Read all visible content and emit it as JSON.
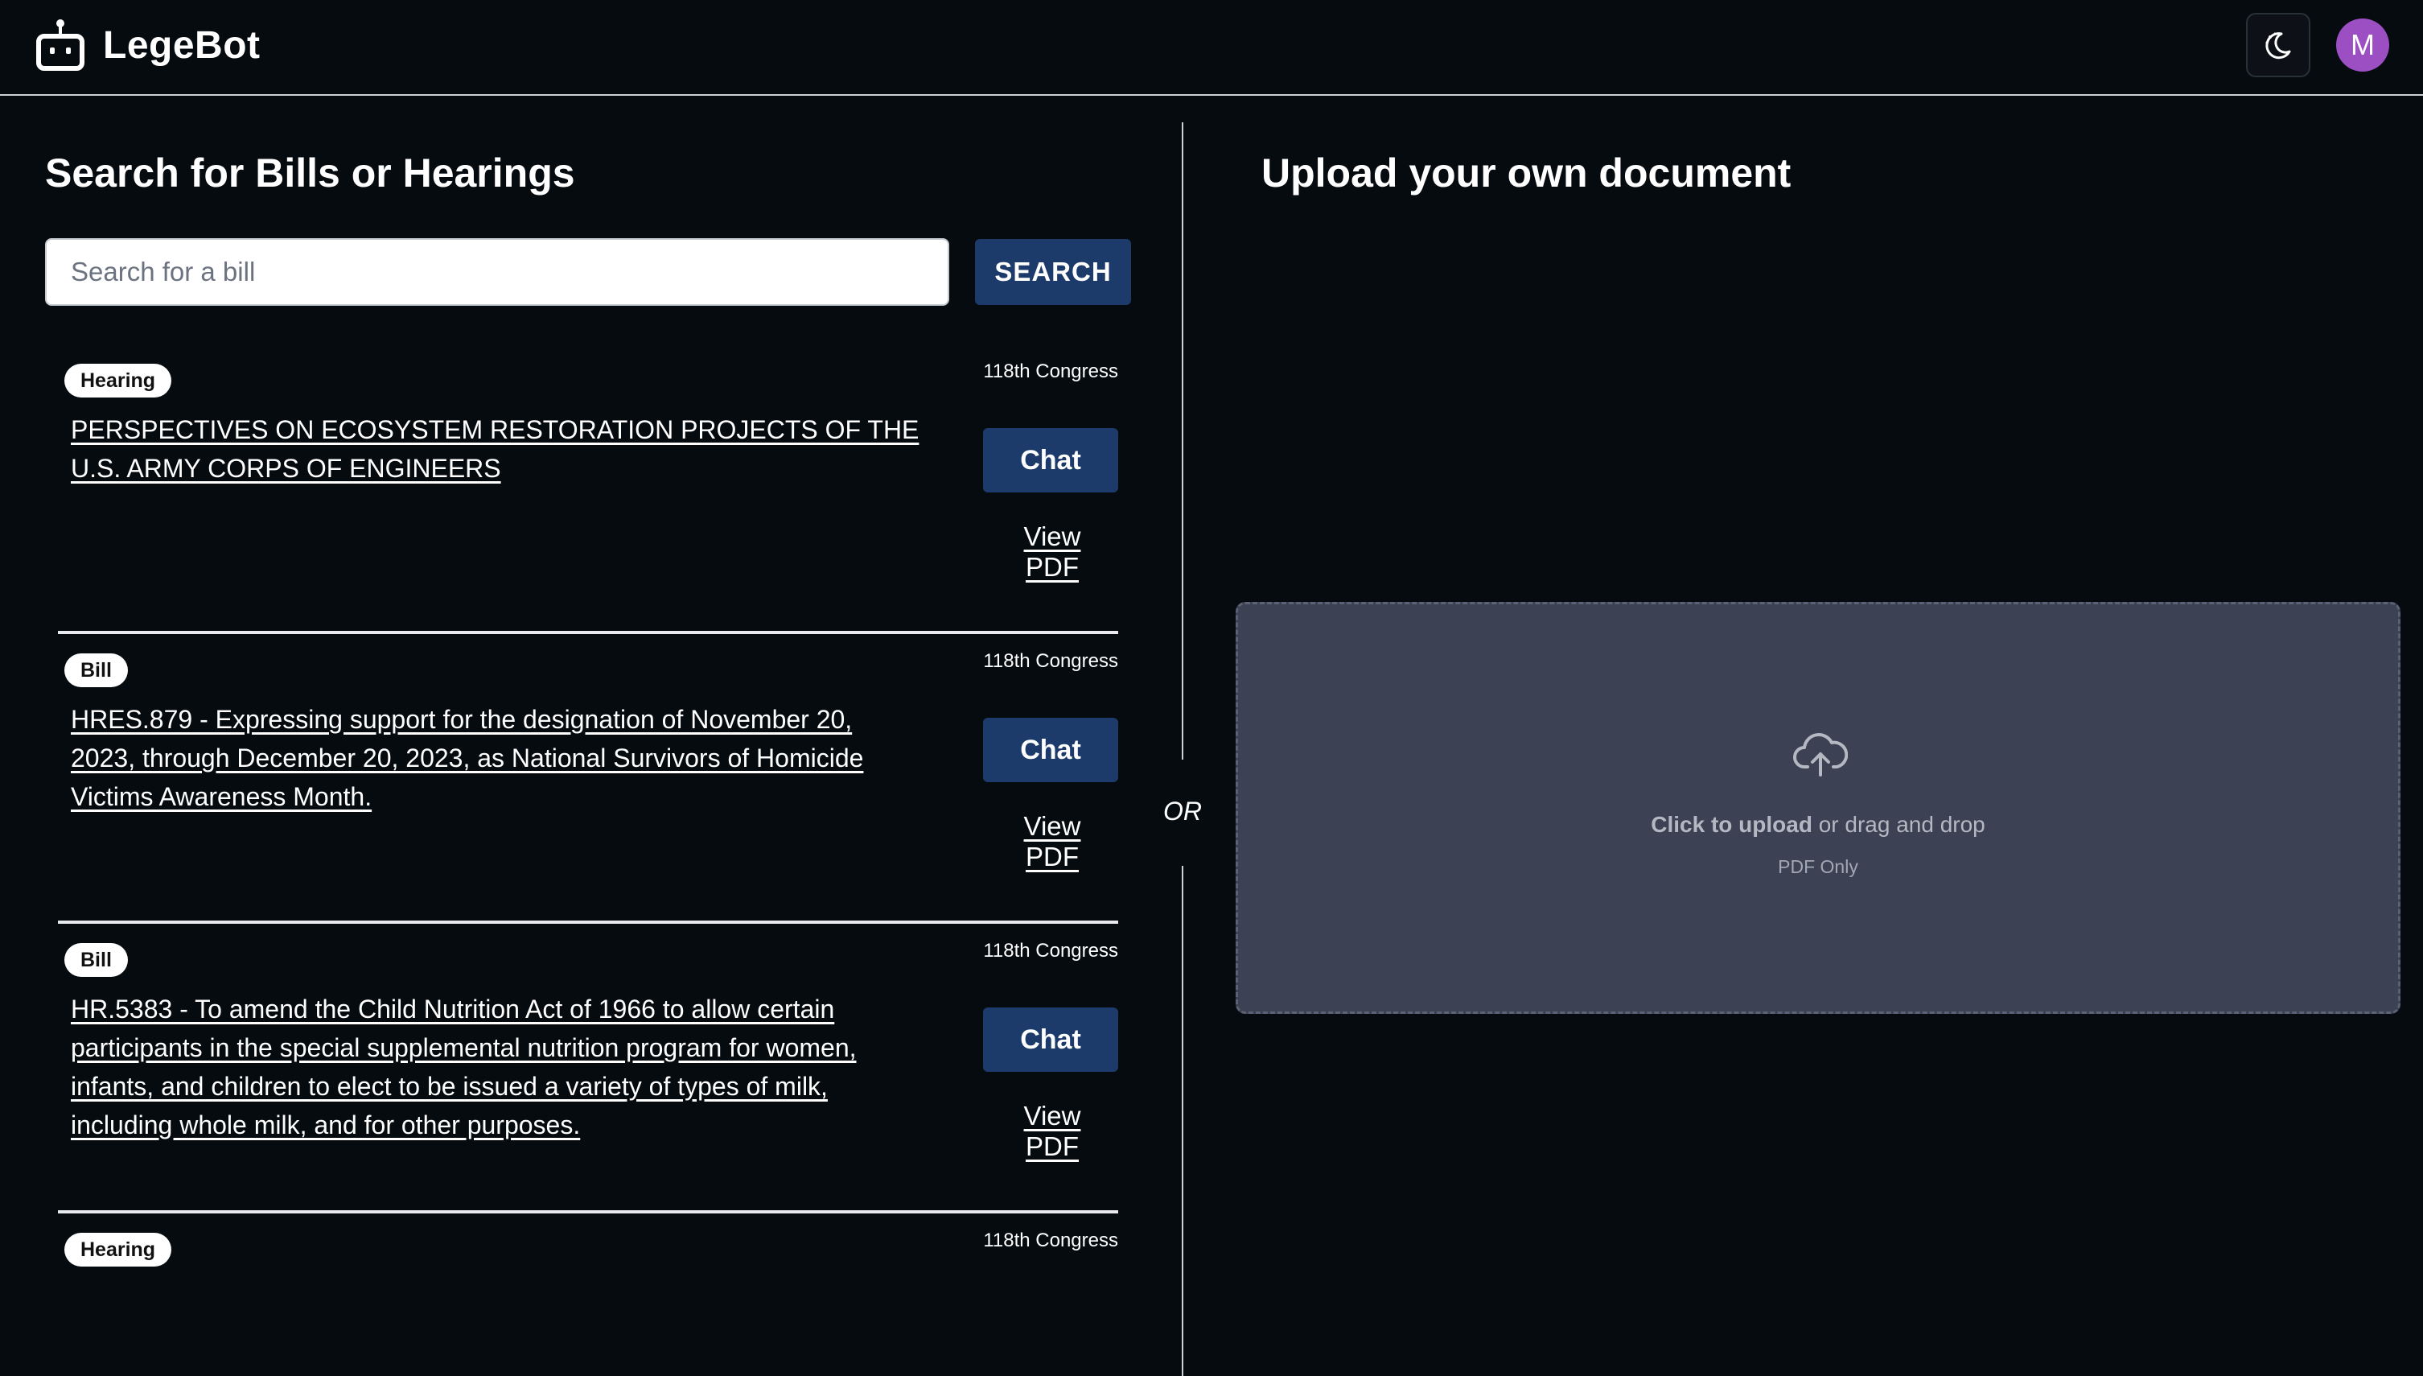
{
  "app": {
    "name": "LegeBot"
  },
  "header": {
    "avatar_initial": "M"
  },
  "search": {
    "title": "Search for Bills or Hearings",
    "placeholder": "Search for a bill",
    "button_label": "SEARCH"
  },
  "results": [
    {
      "badge": "Hearing",
      "congress": "118th Congress",
      "title": "PERSPECTIVES ON ECOSYSTEM RESTORATION PROJECTS OF THE U.S. ARMY CORPS OF ENGINEERS",
      "chat_label": "Chat",
      "pdf_label": "View PDF"
    },
    {
      "badge": "Bill",
      "congress": "118th Congress",
      "title": "HRES.879 - Expressing support for the designation of November 20, 2023, through December 20, 2023, as National Survivors of Homicide Victims Awareness Month.",
      "chat_label": "Chat",
      "pdf_label": "View PDF"
    },
    {
      "badge": "Bill",
      "congress": "118th Congress",
      "title": "HR.5383 - To amend the Child Nutrition Act of 1966 to allow certain participants in the special supplemental nutrition program for women, infants, and children to elect to be issued a variety of types of milk, including whole milk, and for other purposes.",
      "chat_label": "Chat",
      "pdf_label": "View PDF"
    },
    {
      "badge": "Hearing",
      "congress": "118th Congress"
    }
  ],
  "separator": {
    "or_label": "OR"
  },
  "upload": {
    "title": "Upload your own document",
    "click_text": "Click to upload",
    "drag_text": " or drag and drop",
    "hint": "PDF Only"
  },
  "colors": {
    "background": "#060b10",
    "primary_button": "#1d3b6a",
    "dropzone": "#3c4253",
    "avatar": "#9b4fc2"
  },
  "icons": {
    "brand": "robot-icon",
    "theme_toggle": "moon-icon",
    "upload": "cloud-upload-icon"
  }
}
